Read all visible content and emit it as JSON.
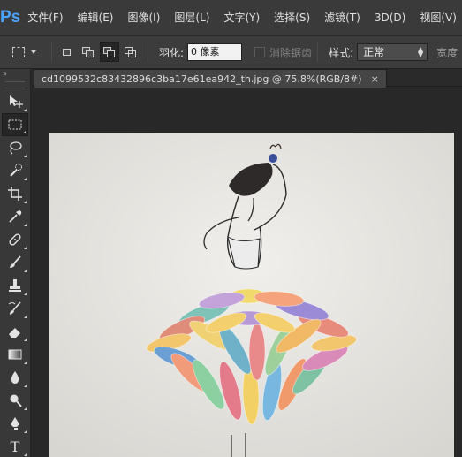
{
  "app": {
    "logo": "Ps"
  },
  "menu": [
    "文件(F)",
    "编辑(E)",
    "图像(I)",
    "图层(L)",
    "文字(Y)",
    "选择(S)",
    "滤镜(T)",
    "3D(D)",
    "视图(V)"
  ],
  "options": {
    "feather_label": "羽化:",
    "feather_value": "0 像素",
    "antialias_label": "消除锯齿",
    "style_label": "样式:",
    "style_value": "正常",
    "width_label": "宽度"
  },
  "document": {
    "tab_title": "cd1099532c83432896c3ba17e61ea942_th.jpg @ 75.8%(RGB/8#)",
    "close_glyph": "×"
  },
  "toolbar": {
    "collapse_glyph": "»",
    "tools": [
      "move-tool",
      "rectangular-marquee-tool",
      "lasso-tool",
      "quick-selection-tool",
      "crop-tool",
      "eyedropper-tool",
      "spot-healing-brush-tool",
      "brush-tool",
      "clone-stamp-tool",
      "history-brush-tool",
      "eraser-tool",
      "gradient-tool",
      "blur-tool",
      "dodge-tool",
      "pen-tool",
      "type-tool"
    ],
    "type_tool_glyph": "T"
  },
  "colors": {
    "menubar": "#3a3a3a",
    "workspace": "#282828",
    "ps_blue": "#4aa3ff",
    "paper": "#e6e5e1"
  }
}
